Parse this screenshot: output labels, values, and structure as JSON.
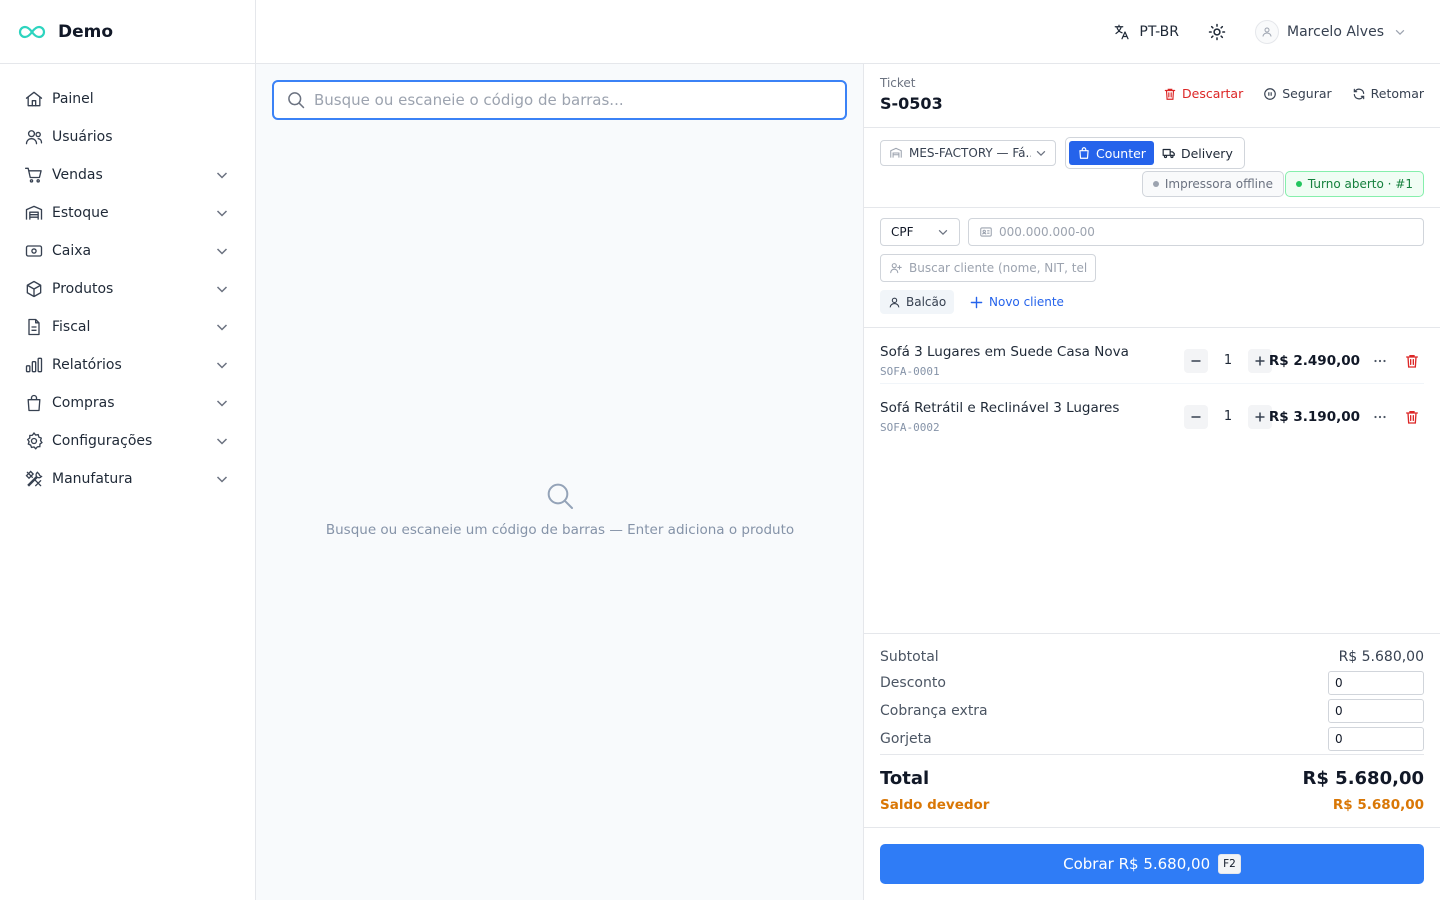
{
  "brand": {
    "name": "Demo"
  },
  "sidebar": {
    "items": [
      {
        "label": "Painel"
      },
      {
        "label": "Usuários"
      },
      {
        "label": "Vendas"
      },
      {
        "label": "Estoque"
      },
      {
        "label": "Caixa"
      },
      {
        "label": "Produtos"
      },
      {
        "label": "Fiscal"
      },
      {
        "label": "Relatórios"
      },
      {
        "label": "Compras"
      },
      {
        "label": "Configurações"
      },
      {
        "label": "Manufatura"
      }
    ]
  },
  "header": {
    "language": "PT-BR",
    "user_name": "Marcelo Alves"
  },
  "search": {
    "placeholder": "Busque ou escaneie o código de barras...",
    "empty_text": "Busque ou escaneie um código de barras — Enter adiciona o produto"
  },
  "ticket": {
    "label": "Ticket",
    "id": "S-0503",
    "actions": {
      "discard": "Descartar",
      "hold": "Segurar",
      "resume": "Retomar"
    }
  },
  "options": {
    "location": "MES-FACTORY — Fá...",
    "modes": {
      "counter": "Counter",
      "delivery": "Delivery"
    },
    "printer_status": "Impressora offline",
    "shift_status": "Turno aberto · #1"
  },
  "customer": {
    "doc_type": "CPF",
    "doc_placeholder": "000.000.000-00",
    "search_placeholder": "Buscar cliente (nome, NIT, telefone)",
    "chip": "Balcão",
    "new_customer": "Novo cliente"
  },
  "cart": {
    "lines": [
      {
        "name": "Sofá 3 Lugares em Suede Casa Nova",
        "sku": "SOFA-0001",
        "qty": "1",
        "price": "R$ 2.490,00"
      },
      {
        "name": "Sofá Retrátil e Reclinável 3 Lugares",
        "sku": "SOFA-0002",
        "qty": "1",
        "price": "R$ 3.190,00"
      }
    ]
  },
  "totals": {
    "subtotal_label": "Subtotal",
    "subtotal": "R$ 5.680,00",
    "discount_label": "Desconto",
    "discount": "0",
    "surcharge_label": "Cobrança extra",
    "surcharge": "0",
    "tip_label": "Gorjeta",
    "tip": "0",
    "total_label": "Total",
    "total": "R$ 5.680,00",
    "due_label": "Saldo devedor",
    "due": "R$ 5.680,00"
  },
  "charge": {
    "label": "Cobrar R$ 5.680,00",
    "shortcut": "F2"
  },
  "colors": {
    "accent": "#2563eb",
    "danger": "#dc2626",
    "success": "#15803d",
    "warning": "#d97706",
    "brand_logo": "#2dd4bf"
  }
}
